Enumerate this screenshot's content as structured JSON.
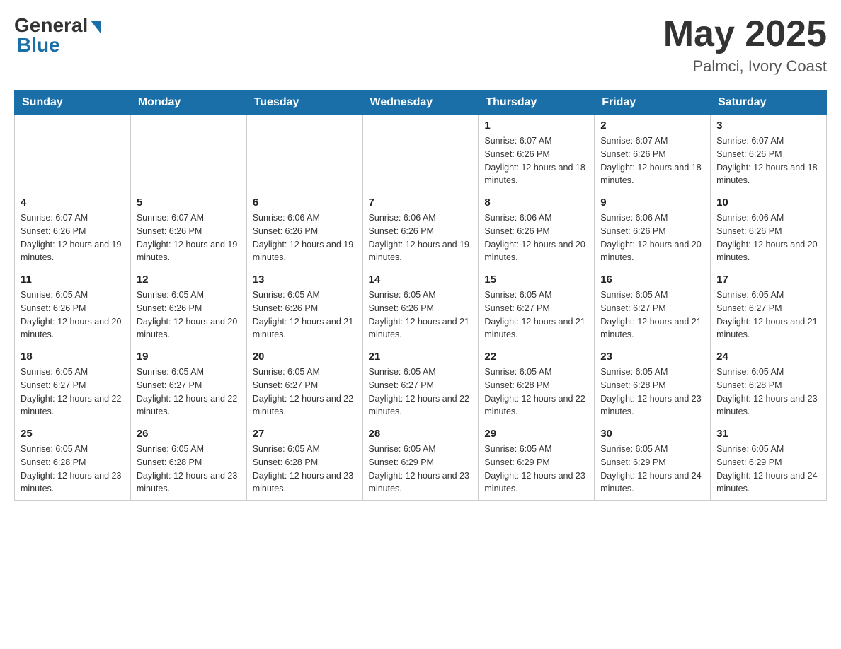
{
  "header": {
    "logo_general": "General",
    "logo_blue": "Blue",
    "title": "May 2025",
    "location": "Palmci, Ivory Coast"
  },
  "days_of_week": [
    "Sunday",
    "Monday",
    "Tuesday",
    "Wednesday",
    "Thursday",
    "Friday",
    "Saturday"
  ],
  "weeks": [
    [
      {
        "day": "",
        "sunrise": "",
        "sunset": "",
        "daylight": "",
        "empty": true
      },
      {
        "day": "",
        "sunrise": "",
        "sunset": "",
        "daylight": "",
        "empty": true
      },
      {
        "day": "",
        "sunrise": "",
        "sunset": "",
        "daylight": "",
        "empty": true
      },
      {
        "day": "",
        "sunrise": "",
        "sunset": "",
        "daylight": "",
        "empty": true
      },
      {
        "day": "1",
        "sunrise": "Sunrise: 6:07 AM",
        "sunset": "Sunset: 6:26 PM",
        "daylight": "Daylight: 12 hours and 18 minutes.",
        "empty": false
      },
      {
        "day": "2",
        "sunrise": "Sunrise: 6:07 AM",
        "sunset": "Sunset: 6:26 PM",
        "daylight": "Daylight: 12 hours and 18 minutes.",
        "empty": false
      },
      {
        "day": "3",
        "sunrise": "Sunrise: 6:07 AM",
        "sunset": "Sunset: 6:26 PM",
        "daylight": "Daylight: 12 hours and 18 minutes.",
        "empty": false
      }
    ],
    [
      {
        "day": "4",
        "sunrise": "Sunrise: 6:07 AM",
        "sunset": "Sunset: 6:26 PM",
        "daylight": "Daylight: 12 hours and 19 minutes.",
        "empty": false
      },
      {
        "day": "5",
        "sunrise": "Sunrise: 6:07 AM",
        "sunset": "Sunset: 6:26 PM",
        "daylight": "Daylight: 12 hours and 19 minutes.",
        "empty": false
      },
      {
        "day": "6",
        "sunrise": "Sunrise: 6:06 AM",
        "sunset": "Sunset: 6:26 PM",
        "daylight": "Daylight: 12 hours and 19 minutes.",
        "empty": false
      },
      {
        "day": "7",
        "sunrise": "Sunrise: 6:06 AM",
        "sunset": "Sunset: 6:26 PM",
        "daylight": "Daylight: 12 hours and 19 minutes.",
        "empty": false
      },
      {
        "day": "8",
        "sunrise": "Sunrise: 6:06 AM",
        "sunset": "Sunset: 6:26 PM",
        "daylight": "Daylight: 12 hours and 20 minutes.",
        "empty": false
      },
      {
        "day": "9",
        "sunrise": "Sunrise: 6:06 AM",
        "sunset": "Sunset: 6:26 PM",
        "daylight": "Daylight: 12 hours and 20 minutes.",
        "empty": false
      },
      {
        "day": "10",
        "sunrise": "Sunrise: 6:06 AM",
        "sunset": "Sunset: 6:26 PM",
        "daylight": "Daylight: 12 hours and 20 minutes.",
        "empty": false
      }
    ],
    [
      {
        "day": "11",
        "sunrise": "Sunrise: 6:05 AM",
        "sunset": "Sunset: 6:26 PM",
        "daylight": "Daylight: 12 hours and 20 minutes.",
        "empty": false
      },
      {
        "day": "12",
        "sunrise": "Sunrise: 6:05 AM",
        "sunset": "Sunset: 6:26 PM",
        "daylight": "Daylight: 12 hours and 20 minutes.",
        "empty": false
      },
      {
        "day": "13",
        "sunrise": "Sunrise: 6:05 AM",
        "sunset": "Sunset: 6:26 PM",
        "daylight": "Daylight: 12 hours and 21 minutes.",
        "empty": false
      },
      {
        "day": "14",
        "sunrise": "Sunrise: 6:05 AM",
        "sunset": "Sunset: 6:26 PM",
        "daylight": "Daylight: 12 hours and 21 minutes.",
        "empty": false
      },
      {
        "day": "15",
        "sunrise": "Sunrise: 6:05 AM",
        "sunset": "Sunset: 6:27 PM",
        "daylight": "Daylight: 12 hours and 21 minutes.",
        "empty": false
      },
      {
        "day": "16",
        "sunrise": "Sunrise: 6:05 AM",
        "sunset": "Sunset: 6:27 PM",
        "daylight": "Daylight: 12 hours and 21 minutes.",
        "empty": false
      },
      {
        "day": "17",
        "sunrise": "Sunrise: 6:05 AM",
        "sunset": "Sunset: 6:27 PM",
        "daylight": "Daylight: 12 hours and 21 minutes.",
        "empty": false
      }
    ],
    [
      {
        "day": "18",
        "sunrise": "Sunrise: 6:05 AM",
        "sunset": "Sunset: 6:27 PM",
        "daylight": "Daylight: 12 hours and 22 minutes.",
        "empty": false
      },
      {
        "day": "19",
        "sunrise": "Sunrise: 6:05 AM",
        "sunset": "Sunset: 6:27 PM",
        "daylight": "Daylight: 12 hours and 22 minutes.",
        "empty": false
      },
      {
        "day": "20",
        "sunrise": "Sunrise: 6:05 AM",
        "sunset": "Sunset: 6:27 PM",
        "daylight": "Daylight: 12 hours and 22 minutes.",
        "empty": false
      },
      {
        "day": "21",
        "sunrise": "Sunrise: 6:05 AM",
        "sunset": "Sunset: 6:27 PM",
        "daylight": "Daylight: 12 hours and 22 minutes.",
        "empty": false
      },
      {
        "day": "22",
        "sunrise": "Sunrise: 6:05 AM",
        "sunset": "Sunset: 6:28 PM",
        "daylight": "Daylight: 12 hours and 22 minutes.",
        "empty": false
      },
      {
        "day": "23",
        "sunrise": "Sunrise: 6:05 AM",
        "sunset": "Sunset: 6:28 PM",
        "daylight": "Daylight: 12 hours and 23 minutes.",
        "empty": false
      },
      {
        "day": "24",
        "sunrise": "Sunrise: 6:05 AM",
        "sunset": "Sunset: 6:28 PM",
        "daylight": "Daylight: 12 hours and 23 minutes.",
        "empty": false
      }
    ],
    [
      {
        "day": "25",
        "sunrise": "Sunrise: 6:05 AM",
        "sunset": "Sunset: 6:28 PM",
        "daylight": "Daylight: 12 hours and 23 minutes.",
        "empty": false
      },
      {
        "day": "26",
        "sunrise": "Sunrise: 6:05 AM",
        "sunset": "Sunset: 6:28 PM",
        "daylight": "Daylight: 12 hours and 23 minutes.",
        "empty": false
      },
      {
        "day": "27",
        "sunrise": "Sunrise: 6:05 AM",
        "sunset": "Sunset: 6:28 PM",
        "daylight": "Daylight: 12 hours and 23 minutes.",
        "empty": false
      },
      {
        "day": "28",
        "sunrise": "Sunrise: 6:05 AM",
        "sunset": "Sunset: 6:29 PM",
        "daylight": "Daylight: 12 hours and 23 minutes.",
        "empty": false
      },
      {
        "day": "29",
        "sunrise": "Sunrise: 6:05 AM",
        "sunset": "Sunset: 6:29 PM",
        "daylight": "Daylight: 12 hours and 23 minutes.",
        "empty": false
      },
      {
        "day": "30",
        "sunrise": "Sunrise: 6:05 AM",
        "sunset": "Sunset: 6:29 PM",
        "daylight": "Daylight: 12 hours and 24 minutes.",
        "empty": false
      },
      {
        "day": "31",
        "sunrise": "Sunrise: 6:05 AM",
        "sunset": "Sunset: 6:29 PM",
        "daylight": "Daylight: 12 hours and 24 minutes.",
        "empty": false
      }
    ]
  ]
}
